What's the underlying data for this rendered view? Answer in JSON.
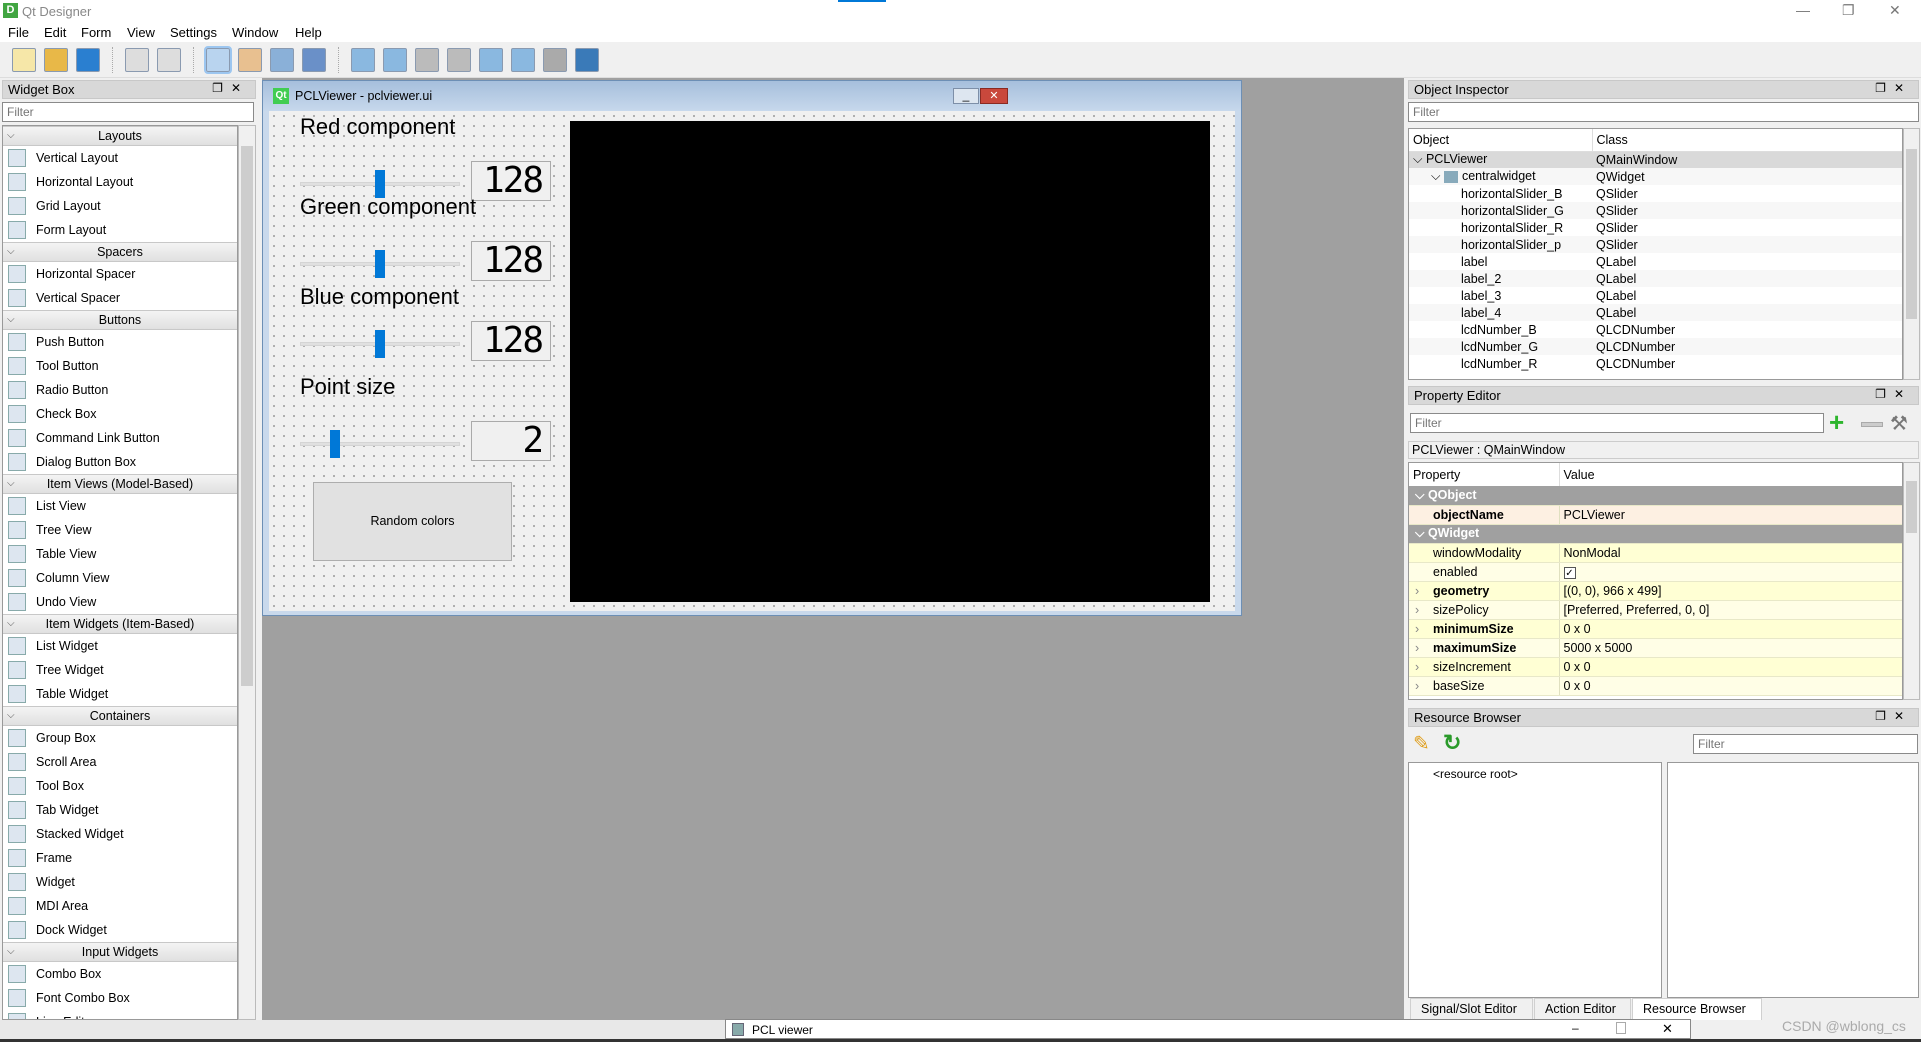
{
  "app": {
    "title": "Qt Designer",
    "icon": "D"
  },
  "menubar": [
    "File",
    "Edit",
    "Form",
    "View",
    "Settings",
    "Window",
    "Help"
  ],
  "toolbar": {
    "groups": [
      [
        "new-file-icon",
        "open-folder-icon",
        "save-icon"
      ],
      [
        "copy-icon",
        "paste-icon"
      ],
      [
        "edit-widgets-icon",
        "edit-signals-slots-icon",
        "edit-buddies-icon",
        "edit-tab-order-icon"
      ],
      [
        "layout-horizontal-icon",
        "layout-vertical-icon",
        "layout-horizontal-splitter-icon",
        "layout-vertical-splitter-icon",
        "layout-grid-icon",
        "layout-form-icon",
        "break-layout-icon",
        "adjust-size-icon"
      ]
    ]
  },
  "widget_box": {
    "title": "Widget Box",
    "filter_placeholder": "Filter",
    "sections": [
      {
        "title": "Layouts",
        "items": [
          "Vertical Layout",
          "Horizontal Layout",
          "Grid Layout",
          "Form Layout"
        ]
      },
      {
        "title": "Spacers",
        "items": [
          "Horizontal Spacer",
          "Vertical Spacer"
        ]
      },
      {
        "title": "Buttons",
        "items": [
          "Push Button",
          "Tool Button",
          "Radio Button",
          "Check Box",
          "Command Link Button",
          "Dialog Button Box"
        ]
      },
      {
        "title": "Item Views (Model-Based)",
        "items": [
          "List View",
          "Tree View",
          "Table View",
          "Column View",
          "Undo View"
        ]
      },
      {
        "title": "Item Widgets (Item-Based)",
        "items": [
          "List Widget",
          "Tree Widget",
          "Table Widget"
        ]
      },
      {
        "title": "Containers",
        "items": [
          "Group Box",
          "Scroll Area",
          "Tool Box",
          "Tab Widget",
          "Stacked Widget",
          "Frame",
          "Widget",
          "MDI Area",
          "Dock Widget"
        ]
      },
      {
        "title": "Input Widgets",
        "items": [
          "Combo Box",
          "Font Combo Box",
          "Line Edit"
        ]
      }
    ]
  },
  "form": {
    "title": "PCLViewer - pclviewer.ui",
    "icon": "Qt",
    "button": "Random colors",
    "controls": [
      {
        "label": "Red component",
        "value": "128",
        "slider": 0.5
      },
      {
        "label": "Green component",
        "value": "128",
        "slider": 0.5
      },
      {
        "label": "Blue component",
        "value": "128",
        "slider": 0.5
      },
      {
        "label": "Point size",
        "value": "2",
        "slider": 0.2
      }
    ],
    "slider_color": "#0078d7"
  },
  "object_inspector": {
    "title": "Object Inspector",
    "filter_placeholder": "Filter",
    "columns": [
      "Object",
      "Class"
    ],
    "rows": [
      {
        "object": "PCLViewer",
        "class": "QMainWindow",
        "level": 0,
        "expanded": true,
        "selected": true
      },
      {
        "object": "centralwidget",
        "class": "QWidget",
        "level": 1,
        "expanded": true
      },
      {
        "object": "horizontalSlider_B",
        "class": "QSlider",
        "level": 2
      },
      {
        "object": "horizontalSlider_G",
        "class": "QSlider",
        "level": 2
      },
      {
        "object": "horizontalSlider_R",
        "class": "QSlider",
        "level": 2
      },
      {
        "object": "horizontalSlider_p",
        "class": "QSlider",
        "level": 2
      },
      {
        "object": "label",
        "class": "QLabel",
        "level": 2
      },
      {
        "object": "label_2",
        "class": "QLabel",
        "level": 2
      },
      {
        "object": "label_3",
        "class": "QLabel",
        "level": 2
      },
      {
        "object": "label_4",
        "class": "QLabel",
        "level": 2
      },
      {
        "object": "lcdNumber_B",
        "class": "QLCDNumber",
        "level": 2
      },
      {
        "object": "lcdNumber_G",
        "class": "QLCDNumber",
        "level": 2
      },
      {
        "object": "lcdNumber_R",
        "class": "QLCDNumber",
        "level": 2
      }
    ]
  },
  "property_editor": {
    "title": "Property Editor",
    "filter_placeholder": "Filter",
    "context": "PCLViewer : QMainWindow",
    "columns": [
      "Property",
      "Value"
    ],
    "rows": [
      {
        "group": "QObject"
      },
      {
        "name": "objectName",
        "value": "PCLViewer",
        "bold": true
      },
      {
        "group": "QWidget"
      },
      {
        "name": "windowModality",
        "value": "NonModal"
      },
      {
        "name": "enabled",
        "value": "",
        "checked": true
      },
      {
        "name": "geometry",
        "value": "[(0, 0), 966 x 499]",
        "bold": true,
        "expandable": true
      },
      {
        "name": "sizePolicy",
        "value": "[Preferred, Preferred, 0, 0]",
        "expandable": true
      },
      {
        "name": "minimumSize",
        "value": "0 x 0",
        "bold": true,
        "expandable": true
      },
      {
        "name": "maximumSize",
        "value": "5000 x 5000",
        "bold": true,
        "expandable": true
      },
      {
        "name": "sizeIncrement",
        "value": "0 x 0",
        "expandable": true
      },
      {
        "name": "baseSize",
        "value": "0 x 0",
        "expandable": true
      }
    ]
  },
  "resource_browser": {
    "title": "Resource Browser",
    "filter_placeholder": "Filter",
    "root": "<resource root>"
  },
  "bottom_tabs": [
    "Signal/Slot Editor",
    "Action Editor",
    "Resource Browser"
  ],
  "active_bottom_tab": "Resource Browser",
  "preview_window": {
    "title": "PCL viewer"
  },
  "watermark": "CSDN @wblong_cs"
}
